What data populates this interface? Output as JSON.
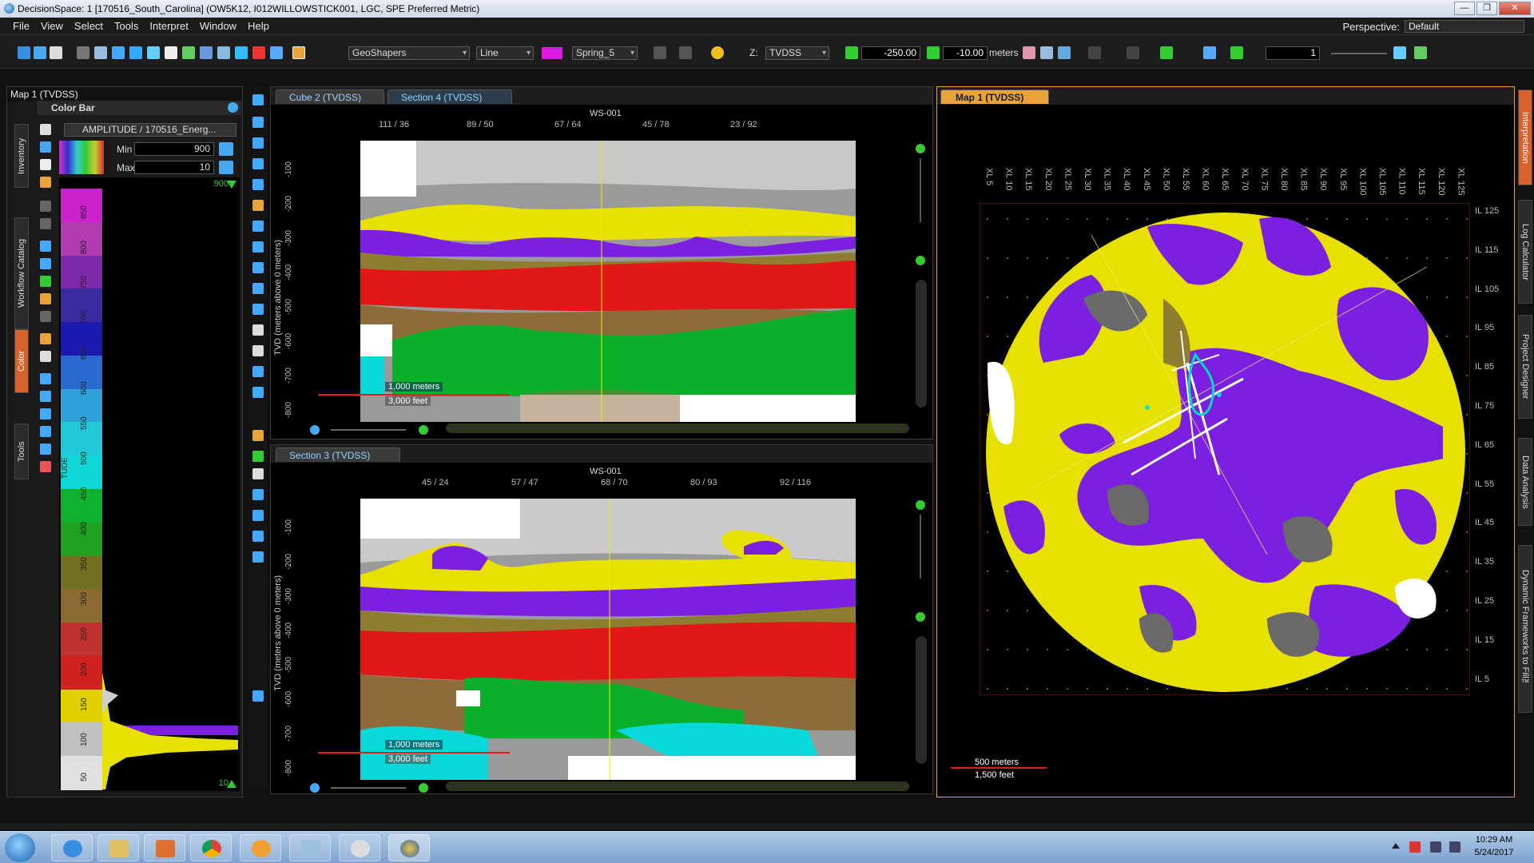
{
  "window": {
    "title": "DecisionSpace: 1 [170516_South_Carolina] (OW5K12, I012WILLOWSTICK001, LGC, SPE Preferred Metric)",
    "buttons": [
      "—",
      "❐",
      "✕"
    ]
  },
  "menu": {
    "items": [
      "File",
      "View",
      "Select",
      "Tools",
      "Interpret",
      "Window",
      "Help"
    ],
    "perspective_label": "Perspective:",
    "perspective_value": "Default"
  },
  "toolbar": {
    "geoshapers": "GeoShapers",
    "line": "Line",
    "colormap": "Spring_5",
    "z_label": "Z:",
    "z_domain": "TVDSS",
    "depth_from": "-250.00",
    "depth_to": "-10.00",
    "units": "meters",
    "step": "1",
    "accent": "#e018e0"
  },
  "left_panel": {
    "title": "Map 1 (TVDSS)",
    "colorbar_title": "Color Bar",
    "attribute": "AMPLITUDE / 170516_Energ...",
    "min_label": "Min",
    "min_value": "900",
    "max_label": "Max",
    "max_value": "10",
    "top_value": "900",
    "bottom_value": "10",
    "axis_word": "TUDE",
    "scale_ticks": [
      "850",
      "800",
      "750",
      "700",
      "650",
      "600",
      "550",
      "500",
      "450",
      "400",
      "350",
      "300",
      "250",
      "200",
      "150",
      "100",
      "50"
    ],
    "side_tabs": [
      "Inventory",
      "Workflow Catalog",
      "Color",
      "Tools"
    ]
  },
  "section_top": {
    "tabs": [
      "Cube 2 (TVDSS)",
      "Section 4 (TVDSS)"
    ],
    "well": "WS-001",
    "x_ticks": [
      "111 / 36",
      "89 / 50",
      "67 / 64",
      "45 / 78",
      "23 / 92"
    ],
    "y_label": "TVD (meters above 0 meters)",
    "y_ticks": [
      "-100",
      "-200",
      "-300",
      "-400",
      "-500",
      "-600",
      "-700",
      "-800"
    ],
    "scale_m": "1,000 meters",
    "scale_ft": "3,000 feet"
  },
  "section_bottom": {
    "tabs": [
      "Section 3 (TVDSS)"
    ],
    "well": "WS-001",
    "x_ticks": [
      "45 / 24",
      "57 / 47",
      "68 / 70",
      "80 / 93",
      "92 / 116"
    ],
    "y_label": "TVD (meters above 0 meters)",
    "y_ticks": [
      "-100",
      "-200",
      "-300",
      "-400",
      "-500",
      "-600",
      "-700",
      "-800"
    ],
    "scale_m": "1,000 meters",
    "scale_ft": "3,000 feet"
  },
  "map": {
    "tab": "Map 1 (TVDSS)",
    "xl_ticks": [
      "XL 5",
      "XL 10",
      "XL 15",
      "XL 20",
      "XL 25",
      "XL 30",
      "XL 35",
      "XL 40",
      "XL 45",
      "XL 50",
      "XL 55",
      "XL 60",
      "XL 65",
      "XL 70",
      "XL 75",
      "XL 80",
      "XL 85",
      "XL 90",
      "XL 95",
      "XL 100",
      "XL 105",
      "XL 110",
      "XL 115",
      "XL 120",
      "XL 125"
    ],
    "il_ticks": [
      "IL 125",
      "IL 115",
      "IL 105",
      "IL 95",
      "IL 85",
      "IL 75",
      "IL 65",
      "IL 55",
      "IL 45",
      "IL 35",
      "IL 25",
      "IL 15",
      "IL 5"
    ],
    "scale_m": "500 meters",
    "scale_ft": "1,500 feet"
  },
  "right_tabs": [
    "Interpretation",
    "Log Calculator",
    "Project Designer",
    "Data Analysis",
    "Dynamic Frameworks to Fill™"
  ],
  "taskbar": {
    "time": "10:29 AM",
    "date": "5/24/2017"
  }
}
